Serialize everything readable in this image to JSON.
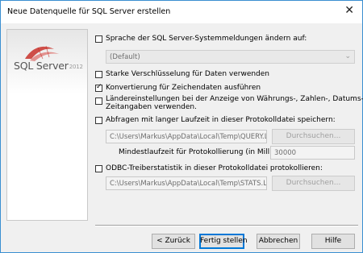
{
  "window": {
    "title": "Neue Datenquelle für SQL Server erstellen",
    "close_glyph": "✕"
  },
  "logo": {
    "product": "SQL Server",
    "year": "2012"
  },
  "options": {
    "language": {
      "label": "Sprache der SQL Server-Systemmeldungen ändern auf:",
      "checked": false,
      "value": "(Default)"
    },
    "encryption": {
      "label": "Starke Verschlüsselung für Daten verwenden",
      "checked": false
    },
    "conversion": {
      "label": "Konvertierung für Zeichendaten ausführen",
      "checked": true
    },
    "regional": {
      "label_line1": "Ländereinstellungen bei der Anzeige von Währungs-, Zahlen-, Datums- und",
      "label_line2": "Zeitangaben verwenden.",
      "checked": false
    },
    "long_queries": {
      "label": "Abfragen mit langer Laufzeit in dieser Protokolldatei speichern:",
      "checked": false,
      "path": "C:\\Users\\Markus\\AppData\\Local\\Temp\\QUERY.LO",
      "browse": "Durchsuchen...",
      "min_time_label": "Mindestlaufzeit für Protokollierung (in Millisekunden):",
      "min_time_value": "30000"
    },
    "odbc_stats": {
      "label": "ODBC-Treiberstatistik in dieser Protokolldatei protokollieren:",
      "checked": false,
      "path": "C:\\Users\\Markus\\AppData\\Local\\Temp\\STATS.LO",
      "browse": "Durchsuchen..."
    }
  },
  "buttons": {
    "back": "< Zurück",
    "finish": "Fertig stellen",
    "cancel": "Abbrechen",
    "help": "Hilfe"
  },
  "colors": {
    "accent": "#0078d7",
    "window_border": "#3a8fd1",
    "logo_red": "#c8312a"
  }
}
